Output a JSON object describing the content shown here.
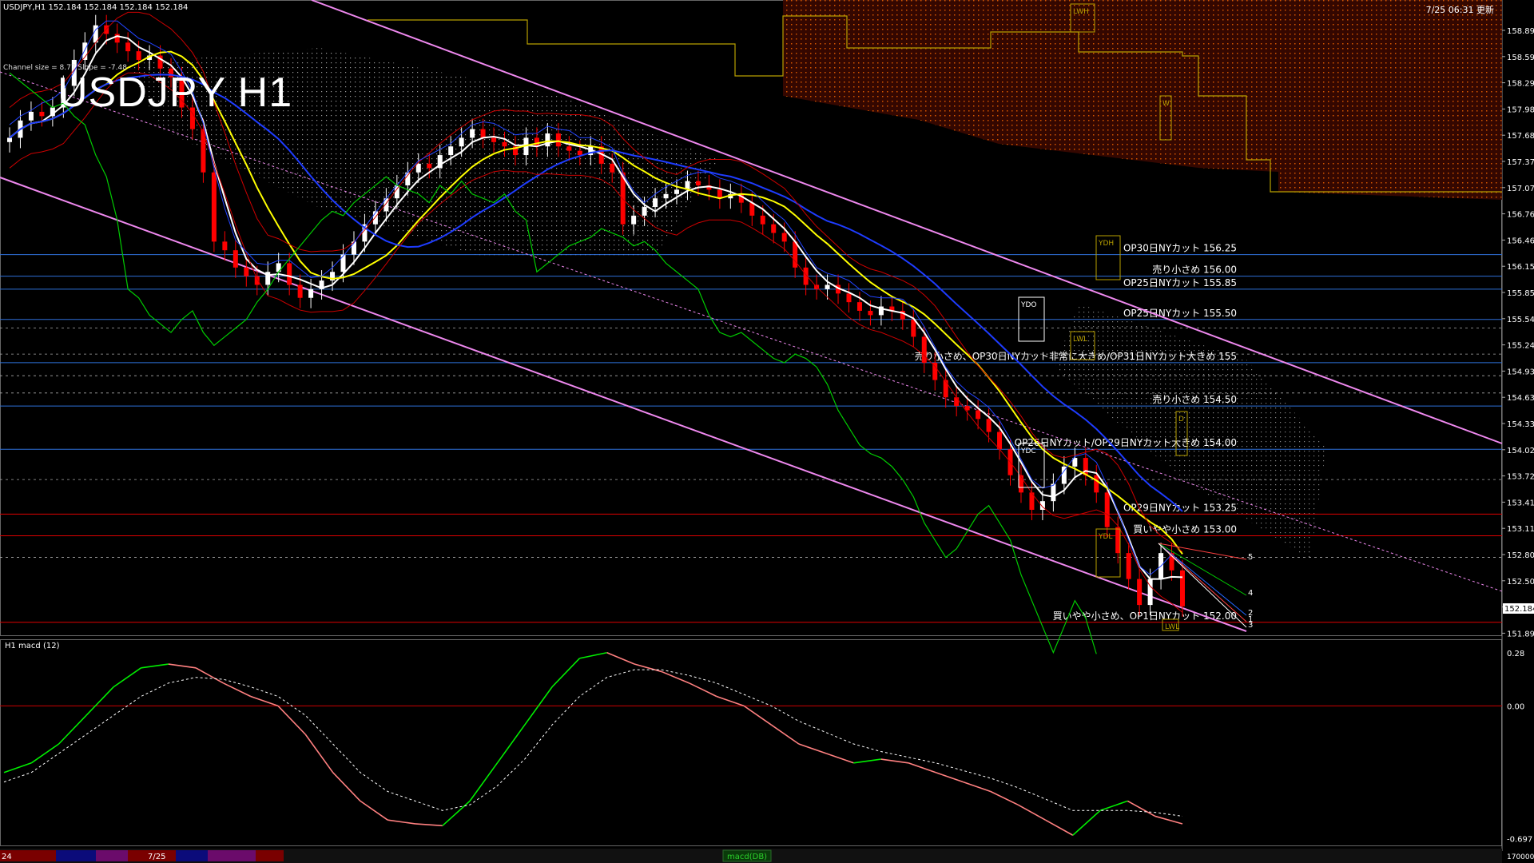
{
  "window": {
    "header_info": "USDJPY,H1  152.184 152.184 152.184 152.184",
    "timestamp": "7/25 06:31 更新",
    "big_title": "USDJPY H1",
    "small_legend": "Channel size = 8.77 Slope = -7.48"
  },
  "colors": {
    "background": "#000000",
    "bull_candle": "#ffffff",
    "bear_candle": "#ff0000",
    "sma_fast": "#ffffff",
    "sma_mid": "#ffff00",
    "sma_slow": "#1e3cff",
    "bollinger": "#cc0000",
    "bollinger_inner": "#2244ff",
    "chikou": "#00cc00",
    "channel": "#ee88ee",
    "cloud": "#ff6a00",
    "macd_up": "#00ee00",
    "macd_down": "#ff8080",
    "macd_signal": "#ffffff",
    "level_blue": "#2e6fd8",
    "level_red": "#dd0000"
  },
  "levels": [
    {
      "label": "OP30日NYカット 156.25",
      "price": 156.25,
      "color": "blue",
      "dashed": false
    },
    {
      "label": "売り小さめ 156.00",
      "price": 156.0,
      "color": "blue",
      "dashed": false
    },
    {
      "label": "OP25日NYカット 155.85",
      "price": 155.85,
      "color": "blue",
      "dashed": false
    },
    {
      "label": "OP25日NYカット 155.50",
      "price": 155.5,
      "color": "blue",
      "dashed": false
    },
    {
      "label": "売り小さめ、OP30日NYカット非常に大きめ/OP31日NYカット大きめ 155",
      "price": 155.0,
      "color": "blue",
      "dashed": false
    },
    {
      "label": "売り小さめ 154.50",
      "price": 154.5,
      "color": "blue",
      "dashed": false
    },
    {
      "label": "OP26日NYカット/OP29日NYカット大きめ 154.00",
      "price": 154.0,
      "color": "blue",
      "dashed": false
    },
    {
      "label": "OP29日NYカット 153.25",
      "price": 153.25,
      "color": "red",
      "dashed": false
    },
    {
      "label": "買いやや小さめ 153.00",
      "price": 153.0,
      "color": "red",
      "dashed": false
    },
    {
      "label": "買いやや小さめ、OP1日NYカット 152.00",
      "price": 152.0,
      "color": "red",
      "dashed": false
    }
  ],
  "box_labels": [
    "LWH",
    "W",
    "YDH",
    "YDO",
    "LWL",
    "YDC",
    "YDL",
    "LWL",
    "D"
  ],
  "numbers_right": [
    "5",
    "4",
    "2",
    "1",
    "3"
  ],
  "price_axis": {
    "ticks": [
      "158.895",
      "158.590",
      "158.290",
      "157.985",
      "157.680",
      "157.375",
      "157.070",
      "156.765",
      "156.460",
      "156.155",
      "155.850",
      "155.545",
      "155.240",
      "154.935",
      "154.635",
      "154.330",
      "154.025",
      "153.720",
      "153.415",
      "153.110",
      "152.805",
      "152.500",
      "152.195",
      "151.890"
    ],
    "current": "152.184"
  },
  "macd": {
    "label": "H1  macd (12)",
    "ticks": [
      "0.28",
      "0.00",
      "-0.697"
    ]
  },
  "bottom_bar": {
    "date_left": "24",
    "date_mid": "7/25",
    "tab_label": "macd(DB)",
    "right_value": "170000"
  },
  "chart_data": {
    "type": "candlestick",
    "title": "USDJPY H1",
    "ylim": [
      151.85,
      159.1
    ],
    "start_price": 157.55,
    "closes": [
      157.6,
      157.8,
      157.9,
      157.85,
      157.95,
      158.2,
      158.5,
      158.7,
      158.9,
      158.8,
      158.7,
      158.6,
      158.5,
      158.55,
      158.4,
      158.3,
      157.95,
      157.7,
      157.2,
      156.4,
      156.3,
      156.1,
      156.0,
      155.9,
      156.05,
      156.15,
      155.9,
      155.75,
      155.85,
      155.95,
      156.05,
      156.25,
      156.4,
      156.6,
      156.75,
      156.9,
      157.05,
      157.2,
      157.3,
      157.25,
      157.4,
      157.5,
      157.6,
      157.7,
      157.6,
      157.55,
      157.5,
      157.4,
      157.6,
      157.5,
      157.65,
      157.5,
      157.45,
      157.4,
      157.5,
      157.3,
      157.2,
      156.6,
      156.7,
      156.8,
      156.9,
      156.95,
      157.0,
      157.1,
      157.05,
      157.0,
      156.9,
      156.95,
      156.85,
      156.7,
      156.6,
      156.5,
      156.4,
      156.1,
      155.9,
      155.85,
      155.9,
      155.8,
      155.7,
      155.6,
      155.55,
      155.65,
      155.6,
      155.5,
      155.3,
      155.0,
      154.8,
      154.6,
      154.5,
      154.45,
      154.35,
      154.2,
      154.0,
      153.7,
      153.5,
      153.3,
      153.4,
      153.6,
      153.8,
      153.9,
      153.7,
      153.5,
      153.1,
      152.8,
      152.5,
      152.2,
      152.5,
      152.8,
      152.6,
      152.184
    ],
    "macd_line": [
      -0.35,
      -0.3,
      -0.2,
      -0.05,
      0.1,
      0.2,
      0.22,
      0.2,
      0.12,
      0.05,
      0.0,
      -0.15,
      -0.35,
      -0.5,
      -0.6,
      -0.62,
      -0.63,
      -0.5,
      -0.3,
      -0.1,
      0.1,
      0.25,
      0.28,
      0.22,
      0.18,
      0.12,
      0.05,
      0.0,
      -0.1,
      -0.2,
      -0.25,
      -0.3,
      -0.28,
      -0.3,
      -0.35,
      -0.4,
      -0.45,
      -0.52,
      -0.6,
      -0.68,
      -0.55,
      -0.5,
      -0.58,
      -0.62
    ],
    "macd_signal": [
      -0.4,
      -0.35,
      -0.25,
      -0.15,
      -0.05,
      0.05,
      0.12,
      0.15,
      0.14,
      0.1,
      0.05,
      -0.05,
      -0.2,
      -0.35,
      -0.45,
      -0.5,
      -0.55,
      -0.52,
      -0.42,
      -0.28,
      -0.1,
      0.05,
      0.15,
      0.19,
      0.19,
      0.16,
      0.12,
      0.06,
      0.0,
      -0.08,
      -0.14,
      -0.2,
      -0.24,
      -0.27,
      -0.3,
      -0.34,
      -0.38,
      -0.43,
      -0.49,
      -0.55,
      -0.55,
      -0.55,
      -0.56,
      -0.58
    ]
  }
}
